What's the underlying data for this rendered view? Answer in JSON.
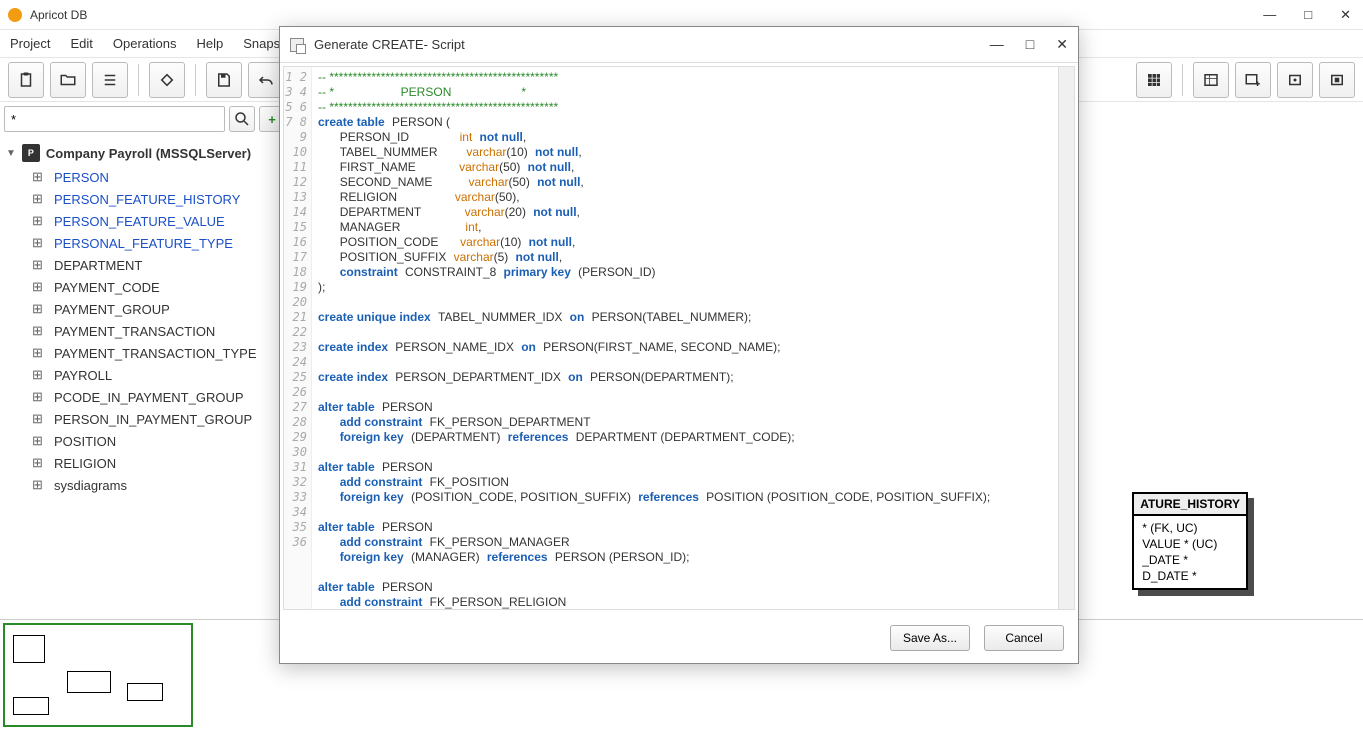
{
  "app": {
    "title": "Apricot DB"
  },
  "menubar": [
    "Project",
    "Edit",
    "Operations",
    "Help",
    "Snapshot:"
  ],
  "search": {
    "value": "*"
  },
  "db": {
    "name": "Company Payroll (MSSQLServer)",
    "tables": [
      {
        "label": "PERSON",
        "blue": true
      },
      {
        "label": "PERSON_FEATURE_HISTORY",
        "blue": true
      },
      {
        "label": "PERSON_FEATURE_VALUE",
        "blue": true
      },
      {
        "label": "PERSONAL_FEATURE_TYPE",
        "blue": true
      },
      {
        "label": "DEPARTMENT",
        "blue": false
      },
      {
        "label": "PAYMENT_CODE",
        "blue": false
      },
      {
        "label": "PAYMENT_GROUP",
        "blue": false
      },
      {
        "label": "PAYMENT_TRANSACTION",
        "blue": false
      },
      {
        "label": "PAYMENT_TRANSACTION_TYPE",
        "blue": false
      },
      {
        "label": "PAYROLL",
        "blue": false
      },
      {
        "label": "PCODE_IN_PAYMENT_GROUP",
        "blue": false
      },
      {
        "label": "PERSON_IN_PAYMENT_GROUP",
        "blue": false
      },
      {
        "label": "POSITION",
        "blue": false
      },
      {
        "label": "RELIGION",
        "blue": false
      },
      {
        "label": "sysdiagrams",
        "blue": false
      }
    ]
  },
  "entity": {
    "title": "ATURE_HISTORY",
    "rows": [
      "* (FK, UC)",
      "VALUE * (UC)",
      "_DATE *",
      "D_DATE *"
    ]
  },
  "modal": {
    "title": "Generate CREATE- Script",
    "save": "Save As...",
    "cancel": "Cancel",
    "lines": 36
  }
}
